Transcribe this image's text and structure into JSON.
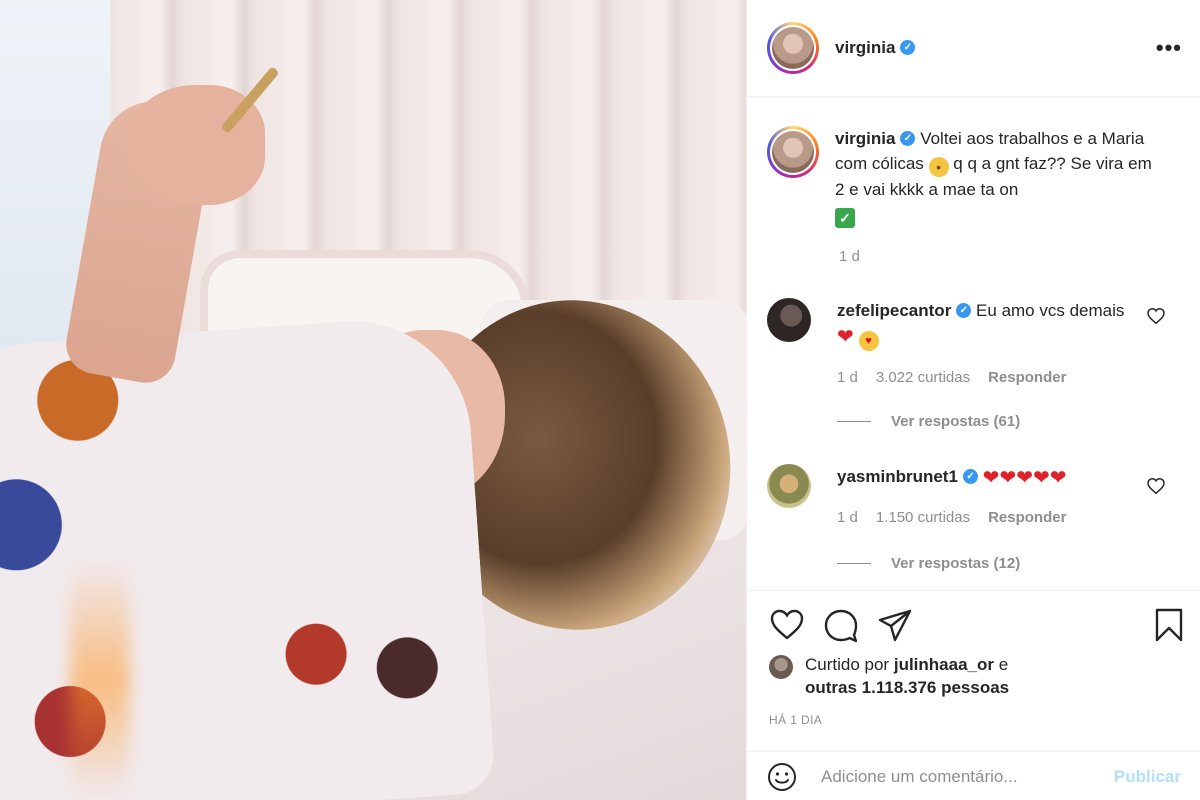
{
  "post": {
    "username": "virginia",
    "verified_mark": "✓",
    "more_label": "•••",
    "caption_text_1": "Voltei aos trabalhos e a Maria com cólicas",
    "caption_text_2": "q q a gnt faz?? Se vira em 2 e vai kkkk a mae ta on",
    "caption_time": "1 d",
    "caption_emojis": [
      "pleading-face",
      "check-mark"
    ]
  },
  "comments": [
    {
      "username": "zefelipecantor",
      "text": "Eu amo vcs demais",
      "emojis": [
        "red-heart",
        "heart-eyes"
      ],
      "time": "1 d",
      "likes": "3.022 curtidas",
      "reply_label": "Responder",
      "view_replies": "Ver respostas (61)"
    },
    {
      "username": "yasminbrunet1",
      "text": "",
      "emojis": [
        "red-heart",
        "red-heart",
        "red-heart",
        "red-heart",
        "red-heart"
      ],
      "time": "1 d",
      "likes": "1.150 curtidas",
      "reply_label": "Responder",
      "view_replies": "Ver respostas (12)"
    }
  ],
  "likes": {
    "prefix": "Curtido por",
    "user": "julinhaaa_or",
    "conj": "e",
    "others": "outras 1.118.376 pessoas"
  },
  "time_ago": "HÁ 1 DIA",
  "add_comment": {
    "placeholder": "Adicione um comentário...",
    "publish_label": "Publicar"
  },
  "icons": [
    "heart-icon",
    "comment-icon",
    "share-icon",
    "bookmark-icon",
    "emoji-icon"
  ],
  "colors": {
    "verified": "#3897f0",
    "muted": "#8e8e8e",
    "publish_disabled": "#b2dffc",
    "heart": "#e0202a"
  }
}
